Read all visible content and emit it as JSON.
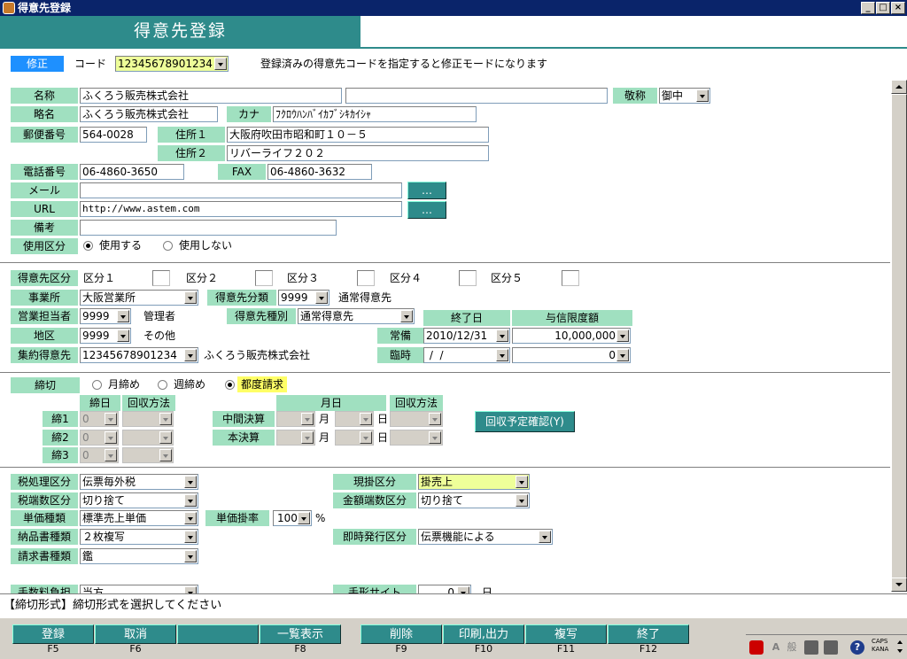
{
  "window": {
    "title": "得意先登録",
    "min": "_",
    "max": "□",
    "close": "×"
  },
  "header": {
    "title": "得意先登録"
  },
  "mode": {
    "badge": "修正",
    "code_label": "コード",
    "code_value": "12345678901234",
    "hint": "登録済みの得意先コードを指定すると修正モードになります"
  },
  "basic": {
    "name_label": "名称",
    "name_value": "ふくろう販売株式会社",
    "name2_value": "",
    "honorific_label": "敬称",
    "honorific_value": "御中",
    "short_label": "略名",
    "short_value": "ふくろう販売株式会社",
    "kana_label": "カナ",
    "kana_value": "ﾌｸﾛｳﾊﾝﾊﾞｲｶﾌﾞｼｷｶｲｼｬ",
    "zip_label": "郵便番号",
    "zip_value": "564-0028",
    "addr1_label": "住所１",
    "addr1_value": "大阪府吹田市昭和町１０－５",
    "addr2_label": "住所２",
    "addr2_value": "リバーライフ２０２",
    "tel_label": "電話番号",
    "tel_value": "06-4860-3650",
    "fax_label": "FAX",
    "fax_value": "06-4860-3632",
    "mail_label": "メール",
    "mail_value": "",
    "url_label": "URL",
    "url_value": "http://www.astem.com",
    "ellipsis": "…",
    "memo_label": "備考",
    "memo_value": "",
    "use_label": "使用区分",
    "use_yes": "使用する",
    "use_no": "使用しない"
  },
  "classification": {
    "label": "得意先区分",
    "k1": "区分１",
    "k2": "区分２",
    "k3": "区分３",
    "k4": "区分４",
    "k5": "区分５",
    "office_label": "事業所",
    "office_value": "大阪営業所",
    "ctype_label": "得意先分類",
    "ctype_code": "9999",
    "ctype_name": "通常得意先",
    "rep_label": "営業担当者",
    "rep_code": "9999",
    "rep_name": "管理者",
    "ckind_label": "得意先種別",
    "ckind_value": "通常得意先",
    "end_label": "終了日",
    "limit_label": "与信限度額",
    "area_label": "地区",
    "area_code": "9999",
    "area_name": "その他",
    "normal_label": "常備",
    "normal_date": "2010/12/31",
    "normal_amount": "10,000,000",
    "group_label": "集約得意先",
    "group_code": "12345678901234",
    "group_name": "ふくろう販売株式会社",
    "temp_label": "臨時",
    "temp_date": " /  / ",
    "temp_amount": "0"
  },
  "closing": {
    "label": "締切",
    "monthly": "月締め",
    "weekly": "週締め",
    "each": "都度請求",
    "day_hdr": "締日",
    "method_hdr": "回収方法",
    "c1": "締1",
    "c2": "締2",
    "c3": "締3",
    "zero": "0",
    "month_day_hdr": "月日",
    "method2_hdr": "回収方法",
    "mid_label": "中間決算",
    "final_label": "本決算",
    "month": "月",
    "day": "日",
    "confirm_btn": "回収予定確認(Y)"
  },
  "tax": {
    "tax_label": "税処理区分",
    "tax_value": "伝票毎外税",
    "cash_label": "現掛区分",
    "cash_value": "掛売上",
    "frac_label": "税端数区分",
    "frac_value": "切り捨て",
    "amtfrac_label": "金額端数区分",
    "amtfrac_value": "切り捨て",
    "price_label": "単価種類",
    "price_value": "標準売上単価",
    "rate_label": "単価掛率",
    "rate_value": "100",
    "pct": "%",
    "delivery_label": "納品書種類",
    "delivery_value": "２枚複写",
    "instant_label": "即時発行区分",
    "instant_value": "伝票機能による",
    "invoice_label": "請求書種類",
    "invoice_value": "鑑",
    "fee_label": "手数料負担",
    "fee_value": "当方",
    "note_label": "手形サイト",
    "note_value": "0",
    "note_unit": "日"
  },
  "message": "【締切形式】締切形式を選択してください",
  "fkeys": [
    {
      "label": "登録",
      "key": "F5"
    },
    {
      "label": "取消",
      "key": "F6"
    },
    {
      "label": "",
      "key": ""
    },
    {
      "label": "一覧表示",
      "key": "F8"
    },
    {
      "label": "削除",
      "key": "F9"
    },
    {
      "label": "印刷,出力",
      "key": "F10"
    },
    {
      "label": "複写",
      "key": "F11"
    },
    {
      "label": "終了",
      "key": "F12"
    }
  ],
  "tray": {
    "ime_a": "A",
    "ime_han": "般",
    "help": "?",
    "caps": "CAPS",
    "kana": "KANA"
  }
}
